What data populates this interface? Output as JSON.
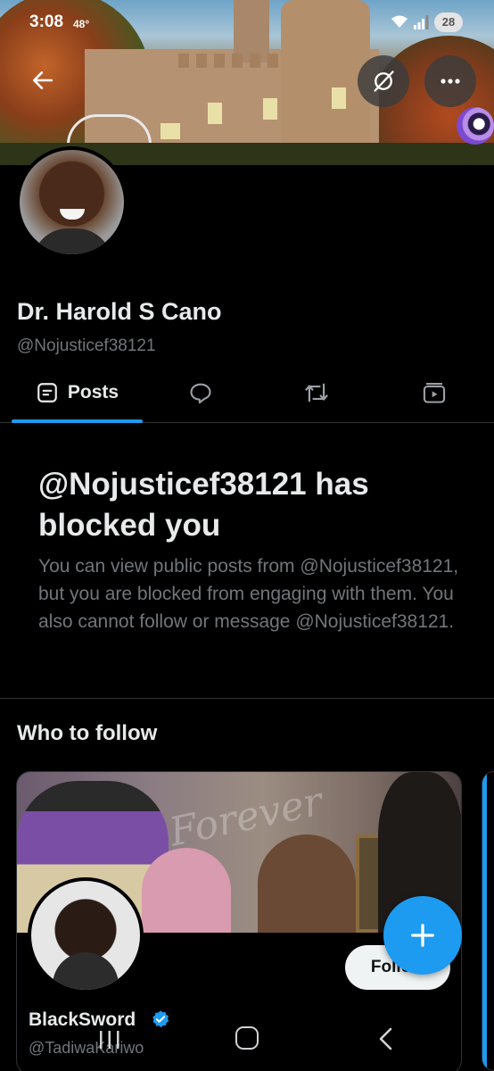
{
  "status_bar": {
    "time": "3:08",
    "temperature": "48°",
    "battery": "28"
  },
  "header": {
    "back_icon": "arrow-left-icon",
    "grok_icon": "slashed-circle-icon",
    "more_icon": "ellipsis-icon"
  },
  "profile": {
    "name": "Dr. Harold S Cano",
    "handle": "@Nojusticef38121"
  },
  "tabs": [
    {
      "label": "Posts",
      "icon": "document-icon",
      "active": true
    },
    {
      "label": "",
      "icon": "speech-bubble-icon",
      "active": false
    },
    {
      "label": "",
      "icon": "repost-icon",
      "active": false
    },
    {
      "label": "",
      "icon": "media-icon",
      "active": false
    }
  ],
  "blocked": {
    "title": "@Nojusticef38121 has blocked you",
    "description": "You can view public posts from @Nojusticef38121, but you are blocked from engaging with them. You also cannot follow or message @Nojusticef38121."
  },
  "who_to_follow": {
    "title": "Who to follow",
    "banner_text": "Forever",
    "card": {
      "name": "BlackSword",
      "handle": "@TadiwaKariwo",
      "verified": true,
      "follow_label": "Follow"
    }
  },
  "fab": {
    "icon": "plus-icon"
  },
  "colors": {
    "accent": "#1d9bf0",
    "background": "#000000",
    "text_primary": "#e7e9ea",
    "text_secondary": "#71767b"
  }
}
